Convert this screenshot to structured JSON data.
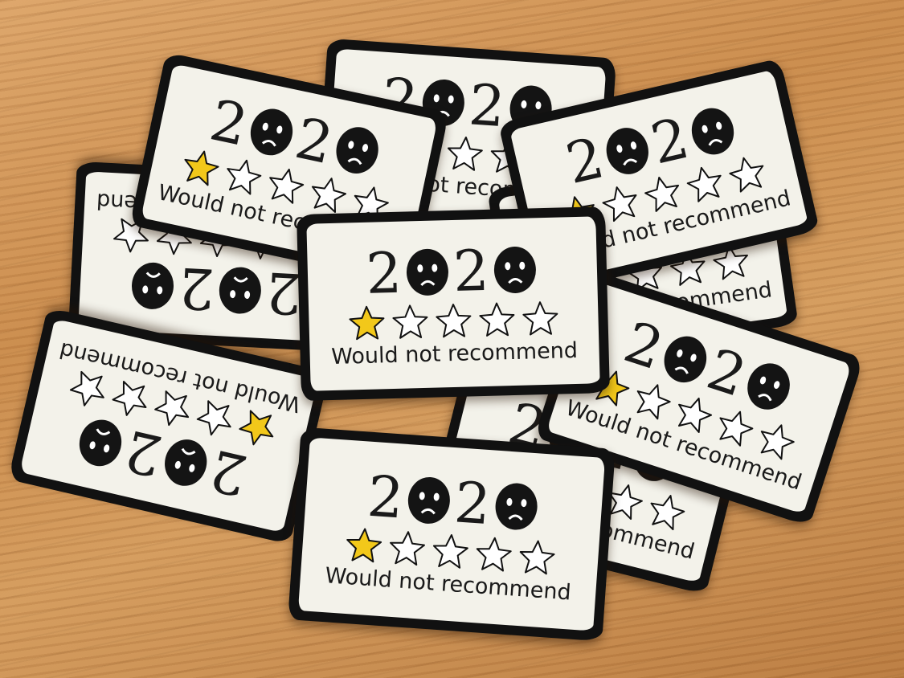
{
  "sticker_label": {
    "year_digit_two": "2",
    "zero_face": "sad-face-zero-icon",
    "caption": "Would not recommend",
    "rating_filled": 1,
    "rating_max": 5
  },
  "colors": {
    "star_filled": "#f2c81a",
    "star_empty": "#ffffff",
    "outline": "#111111",
    "sticker_paper": "#f3f2ea",
    "table_wood": "#c98a4b"
  }
}
